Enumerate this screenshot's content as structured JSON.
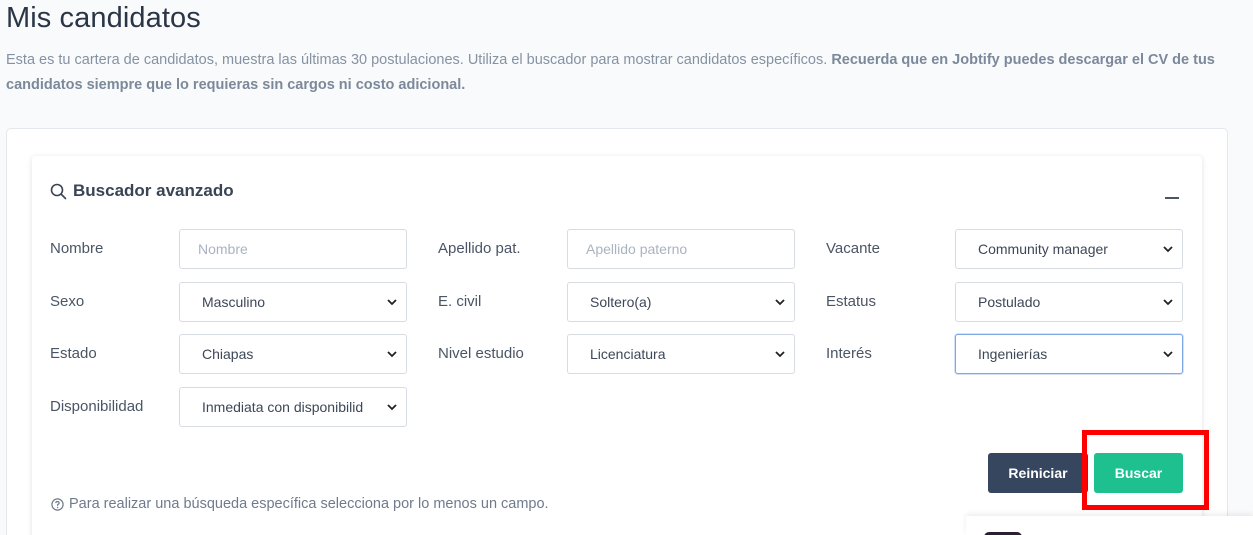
{
  "page": {
    "title": "Mis candidatos",
    "intro_text": "Esta es tu cartera de candidatos, muestra las últimas 30 postulaciones. Utiliza el buscador para mostrar candidatos específicos. ",
    "intro_bold": "Recuerda que en Jobtify puedes descargar el CV de tus candidatos siempre que lo requieras sin cargos ni costo adicional."
  },
  "search": {
    "title": "Buscador avanzado",
    "fields": {
      "nombre": {
        "label": "Nombre",
        "placeholder": "Nombre"
      },
      "apellido": {
        "label": "Apellido pat.",
        "placeholder": "Apellido paterno"
      },
      "vacante": {
        "label": "Vacante",
        "value": "Community manager"
      },
      "sexo": {
        "label": "Sexo",
        "value": "Masculino"
      },
      "civil": {
        "label": "E. civil",
        "value": "Soltero(a)"
      },
      "estatus": {
        "label": "Estatus",
        "value": "Postulado"
      },
      "estado": {
        "label": "Estado",
        "value": "Chiapas"
      },
      "nivel": {
        "label": "Nivel estudio",
        "value": "Licenciatura"
      },
      "interes": {
        "label": "Interés",
        "value": "Ingenierías"
      },
      "disponibilidad": {
        "label": "Disponibilidad",
        "value": "Inmediata con disponibilid"
      }
    },
    "reset_label": "Reiniciar",
    "search_label": "Buscar",
    "hint": "Para realizar una búsqueda específica selecciona por lo menos un campo."
  },
  "colors": {
    "primary_dark": "#36465e",
    "accent_green": "#1ec08f",
    "highlight": "#ff0000"
  }
}
